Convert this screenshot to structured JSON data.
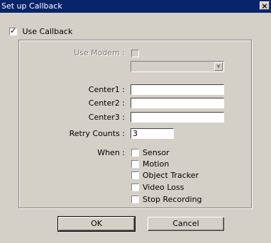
{
  "window": {
    "title": "Set up Callback",
    "close_glyph": "×"
  },
  "use_callback": {
    "label": "Use Callback",
    "checked": true
  },
  "modem": {
    "label": "Use Modem :",
    "checked": false,
    "combo_value": ""
  },
  "centers": [
    {
      "label": "Center1 :",
      "value": ""
    },
    {
      "label": "Center2 :",
      "value": ""
    },
    {
      "label": "Center3 :",
      "value": ""
    }
  ],
  "retry": {
    "label": "Retry Counts :",
    "value": "3"
  },
  "when": {
    "label": "When :",
    "options": [
      {
        "label": "Sensor",
        "checked": false
      },
      {
        "label": "Motion",
        "checked": false
      },
      {
        "label": "Object Tracker",
        "checked": false
      },
      {
        "label": "Video Loss",
        "checked": false
      },
      {
        "label": "Stop Recording",
        "checked": false
      }
    ]
  },
  "buttons": {
    "ok": "OK",
    "cancel": "Cancel"
  }
}
